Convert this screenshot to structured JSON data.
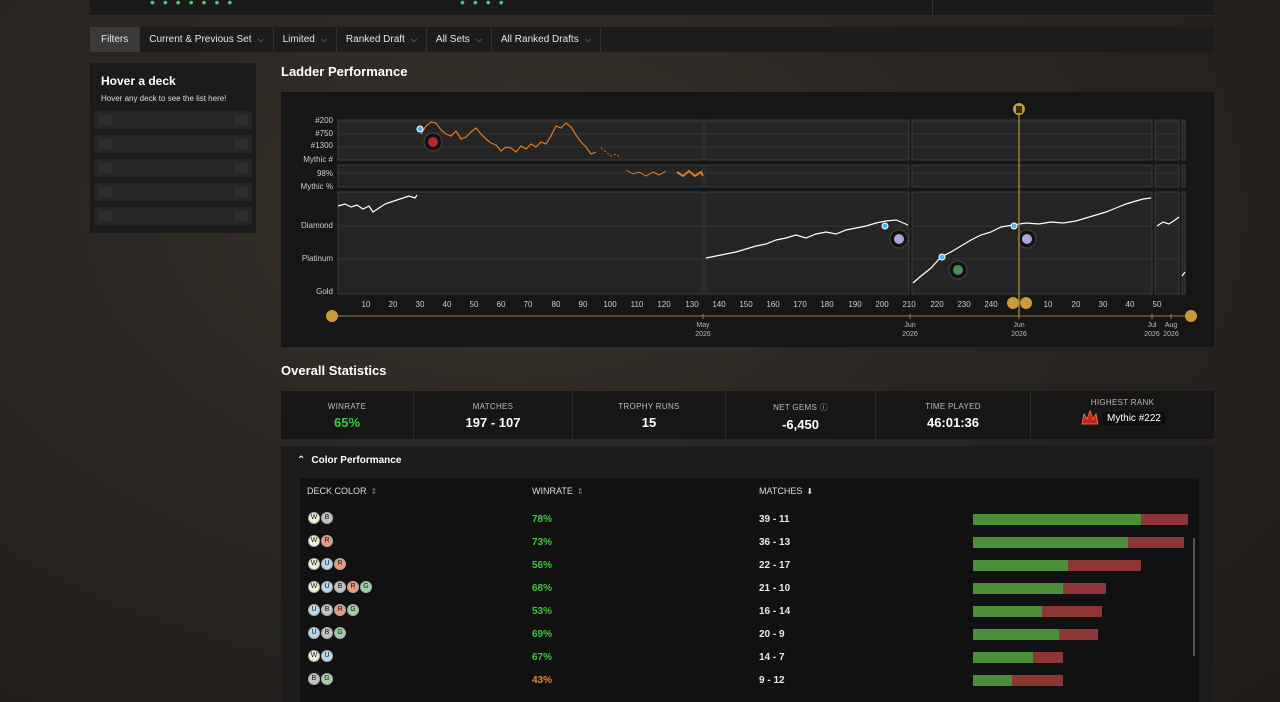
{
  "filters": {
    "label": "Filters",
    "items": [
      "Current & Previous Set",
      "Limited",
      "Ranked Draft",
      "All Sets",
      "All Ranked Drafts"
    ]
  },
  "side_panel": {
    "title": "Hover a deck",
    "subtitle": "Hover any deck to see the list here!"
  },
  "ladder": {
    "title": "Ladder Performance",
    "y_labels_top": [
      "#200",
      "#750",
      "#1300",
      "Mythic #"
    ],
    "y_labels_mid": [
      "98%",
      "Mythic %"
    ],
    "y_labels_bottom": [
      "Diamond",
      "Platinum",
      "Gold"
    ],
    "x_ticks": [
      "10",
      "20",
      "30",
      "40",
      "50",
      "60",
      "70",
      "80",
      "90",
      "100",
      "110",
      "120",
      "130",
      "140",
      "150",
      "160",
      "170",
      "180",
      "190",
      "200",
      "210",
      "220",
      "230",
      "240",
      "10",
      "20",
      "30",
      "40",
      "50"
    ],
    "timeline": [
      {
        "month": "May",
        "year": "2026"
      },
      {
        "month": "Jun",
        "year": "2026"
      },
      {
        "month": "Jun",
        "year": "2026"
      },
      {
        "month": "Jul",
        "year": "2026"
      },
      {
        "month": "Aug",
        "year": "2026"
      }
    ],
    "colors": {
      "mythic_line": "#e07a1f",
      "rank_line": "#ffffff",
      "timeline": "#9a7a3a"
    }
  },
  "overall": {
    "title": "Overall Statistics",
    "stats": [
      {
        "label": "WINRATE",
        "value": "65%"
      },
      {
        "label": "MATCHES",
        "value": "197 - 107"
      },
      {
        "label": "TROPHY RUNS",
        "value": "15"
      },
      {
        "label": "NET GEMS ⓘ",
        "value": "-6,450"
      },
      {
        "label": "TIME PLAYED",
        "value": "46:01:36"
      },
      {
        "label": "HIGHEST RANK",
        "value": "Mythic #222"
      }
    ]
  },
  "color_performance": {
    "title": "Color Performance",
    "headers": {
      "deck_color": "DECK COLOR",
      "winrate": "WINRATE",
      "matches": "MATCHES"
    },
    "rows": [
      {
        "colors": [
          "W",
          "B"
        ],
        "winrate": "78%",
        "matches": "39 - 11",
        "wins": 39,
        "losses": 11
      },
      {
        "colors": [
          "W",
          "R"
        ],
        "winrate": "73%",
        "matches": "36 - 13",
        "wins": 36,
        "losses": 13
      },
      {
        "colors": [
          "W",
          "U",
          "R"
        ],
        "winrate": "56%",
        "matches": "22 - 17",
        "wins": 22,
        "losses": 17
      },
      {
        "colors": [
          "W",
          "U",
          "B",
          "R",
          "G"
        ],
        "winrate": "68%",
        "matches": "21 - 10",
        "wins": 21,
        "losses": 10
      },
      {
        "colors": [
          "U",
          "B",
          "R",
          "G"
        ],
        "winrate": "53%",
        "matches": "16 - 14",
        "wins": 16,
        "losses": 14
      },
      {
        "colors": [
          "U",
          "B",
          "G"
        ],
        "winrate": "69%",
        "matches": "20 - 9",
        "wins": 20,
        "losses": 9
      },
      {
        "colors": [
          "W",
          "U"
        ],
        "winrate": "67%",
        "matches": "14 - 7",
        "wins": 14,
        "losses": 7
      },
      {
        "colors": [
          "B",
          "G"
        ],
        "winrate": "43%",
        "matches": "9 - 12",
        "wins": 9,
        "losses": 12
      }
    ],
    "winrate_colors": {
      "good": "#3cc83c",
      "bad": "#e8862a"
    },
    "pip_colors": {
      "W": "#f4f0d8",
      "U": "#b8d8ef",
      "B": "#c8c0bc",
      "R": "#e89a7c",
      "G": "#9fd0a4"
    }
  }
}
